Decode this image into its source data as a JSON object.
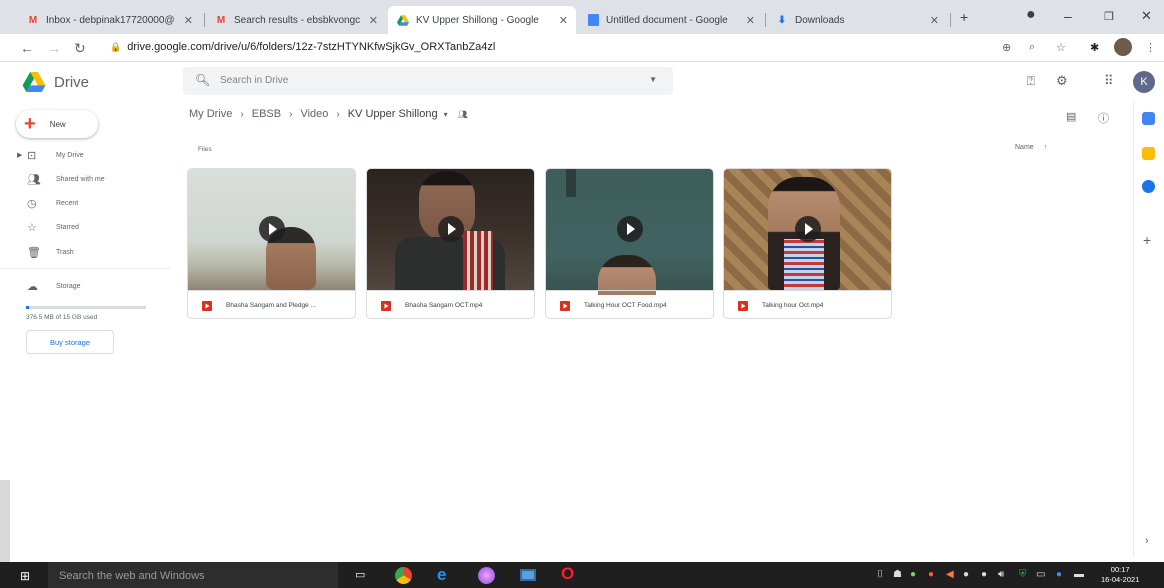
{
  "browser": {
    "tabs": [
      {
        "title": "Inbox - debpinak17720000@",
        "icon": "gmail-icon"
      },
      {
        "title": "Search results - ebsbkvongc",
        "icon": "gmail-icon"
      },
      {
        "title": "KV Upper Shillong - Google",
        "icon": "drive-icon"
      },
      {
        "title": "Untitled document - Google",
        "icon": "docs-icon"
      },
      {
        "title": "Downloads",
        "icon": "download-icon"
      }
    ],
    "new_tab": "+",
    "url": "drive.google.com/drive/u/6/folders/12z-7stzHTYNKfwSjkGv_ORXTanbZa4zl"
  },
  "drive": {
    "title": "Drive",
    "search_placeholder": "Search in Drive",
    "avatar_letter": "K",
    "new_label": "New",
    "nav": [
      {
        "label": "My Drive",
        "icon": "my-drive-icon"
      },
      {
        "label": "Shared with me",
        "icon": "shared-icon"
      },
      {
        "label": "Recent",
        "icon": "clock-icon"
      },
      {
        "label": "Starred",
        "icon": "star-icon"
      },
      {
        "label": "Trash",
        "icon": "trash-icon"
      }
    ],
    "storage_label": "Storage",
    "storage_used_text": "376.5 MB of 15 GB used",
    "storage_used_fraction": 0.025,
    "buy_storage": "Buy storage",
    "breadcrumb": [
      "My Drive",
      "EBSB",
      "Video",
      "KV Upper Shillong"
    ],
    "files_label": "Files",
    "sort_label": "Name",
    "files": [
      {
        "name": "Bhasha Sangam and Pledge ..."
      },
      {
        "name": "Bhasha Sangam OCT.mp4"
      },
      {
        "name": "Talking Hour OCT Food.mp4"
      },
      {
        "name": "Talking hour Oct.mp4"
      }
    ]
  },
  "taskbar": {
    "search_placeholder": "Search the web and Windows",
    "time": "00:17",
    "date": "16-04-2021"
  },
  "colors": {
    "accent": "#1a73e8",
    "new_plus": "#ea4335",
    "video_icon": "#d93025"
  }
}
